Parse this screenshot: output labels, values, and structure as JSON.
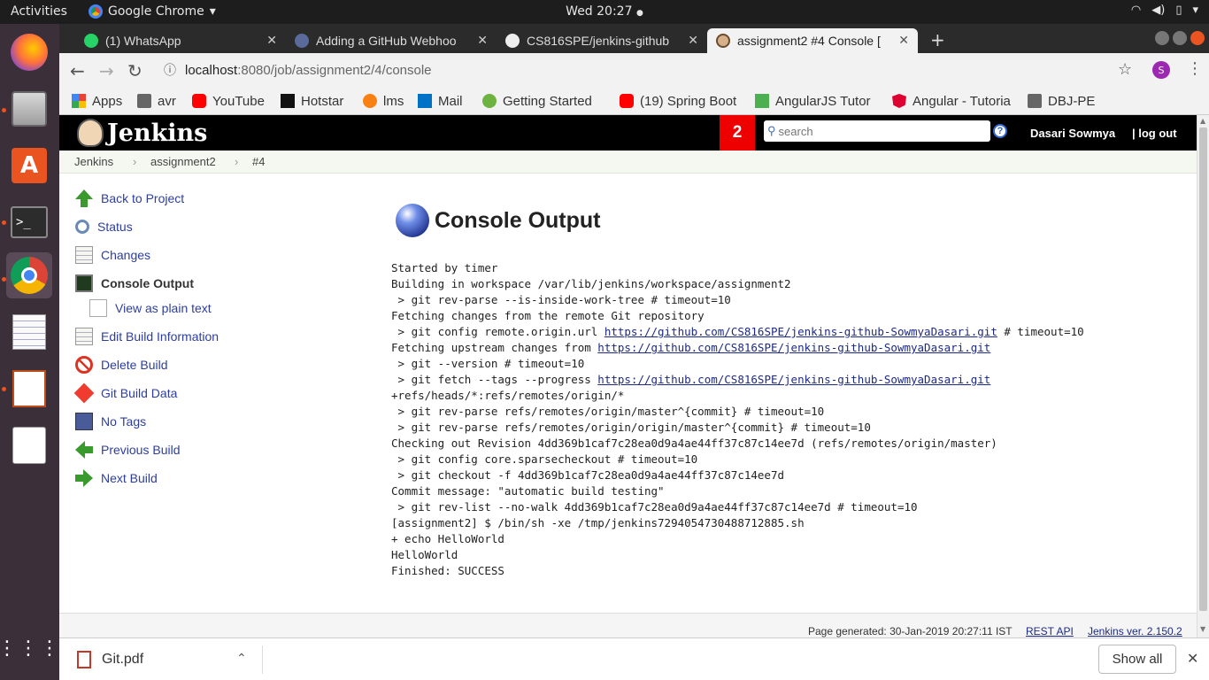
{
  "system": {
    "activities": "Activities",
    "app_name": "Google Chrome",
    "clock": "Wed 20:27"
  },
  "tabs": [
    {
      "label": "(1) WhatsApp",
      "icon": "whatsapp-icon"
    },
    {
      "label": "Adding a GitHub Webhoo",
      "icon": "globe-icon"
    },
    {
      "label": "CS816SPE/jenkins-github",
      "icon": "github-icon"
    },
    {
      "label": "assignment2 #4 Console [",
      "icon": "jenkins-icon"
    }
  ],
  "address": {
    "host": "localhost",
    "rest": ":8080/job/assignment2/4/console"
  },
  "profile_initial": "S",
  "bookmarks": [
    {
      "label": "Apps"
    },
    {
      "label": "avr"
    },
    {
      "label": "YouTube"
    },
    {
      "label": "Hotstar"
    },
    {
      "label": "lms"
    },
    {
      "label": "Mail"
    },
    {
      "label": "Getting Started"
    },
    {
      "label": "(19) Spring Boot"
    },
    {
      "label": "AngularJS Tutor"
    },
    {
      "label": "Angular - Tutoria"
    },
    {
      "label": "DBJ-PE"
    }
  ],
  "jenkins": {
    "logo_text": "Jenkins",
    "notification_count": "2",
    "search_placeholder": "search",
    "user": "Dasari Sowmya",
    "logout": "| log out"
  },
  "breadcrumbs": [
    "Jenkins",
    "assignment2",
    "#4"
  ],
  "sidebar": [
    {
      "label": "Back to Project"
    },
    {
      "label": "Status"
    },
    {
      "label": "Changes"
    },
    {
      "label": "Console Output"
    },
    {
      "label": "View as plain text"
    },
    {
      "label": "Edit Build Information"
    },
    {
      "label": "Delete Build"
    },
    {
      "label": "Git Build Data"
    },
    {
      "label": "No Tags"
    },
    {
      "label": "Previous Build"
    },
    {
      "label": "Next Build"
    }
  ],
  "console": {
    "title": "Console Output",
    "lines": [
      "Started by timer",
      "Building in workspace /var/lib/jenkins/workspace/assignment2",
      " > git rev-parse --is-inside-work-tree # timeout=10",
      "Fetching changes from the remote Git repository",
      {
        "pre": " > git config remote.origin.url ",
        "link": "https://github.com/CS816SPE/jenkins-github-SowmyaDasari.git",
        "post": " # timeout=10"
      },
      {
        "pre": "Fetching upstream changes from ",
        "link": "https://github.com/CS816SPE/jenkins-github-SowmyaDasari.git",
        "post": ""
      },
      " > git --version # timeout=10",
      {
        "pre": " > git fetch --tags --progress ",
        "link": "https://github.com/CS816SPE/jenkins-github-SowmyaDasari.git",
        "post": ""
      },
      "+refs/heads/*:refs/remotes/origin/*",
      " > git rev-parse refs/remotes/origin/master^{commit} # timeout=10",
      " > git rev-parse refs/remotes/origin/origin/master^{commit} # timeout=10",
      "Checking out Revision 4dd369b1caf7c28ea0d9a4ae44ff37c87c14ee7d (refs/remotes/origin/master)",
      " > git config core.sparsecheckout # timeout=10",
      " > git checkout -f 4dd369b1caf7c28ea0d9a4ae44ff37c87c14ee7d",
      "Commit message: \"automatic build testing\"",
      " > git rev-list --no-walk 4dd369b1caf7c28ea0d9a4ae44ff37c87c14ee7d # timeout=10",
      "[assignment2] $ /bin/sh -xe /tmp/jenkins7294054730488712885.sh",
      "+ echo HelloWorld",
      "HelloWorld",
      "Finished: SUCCESS"
    ]
  },
  "footer": {
    "generated": "Page generated: 30-Jan-2019 20:27:11 IST",
    "rest_api": "REST API",
    "version": "Jenkins ver. 2.150.2"
  },
  "downloads": {
    "file": "Git.pdf",
    "show_all": "Show all"
  }
}
